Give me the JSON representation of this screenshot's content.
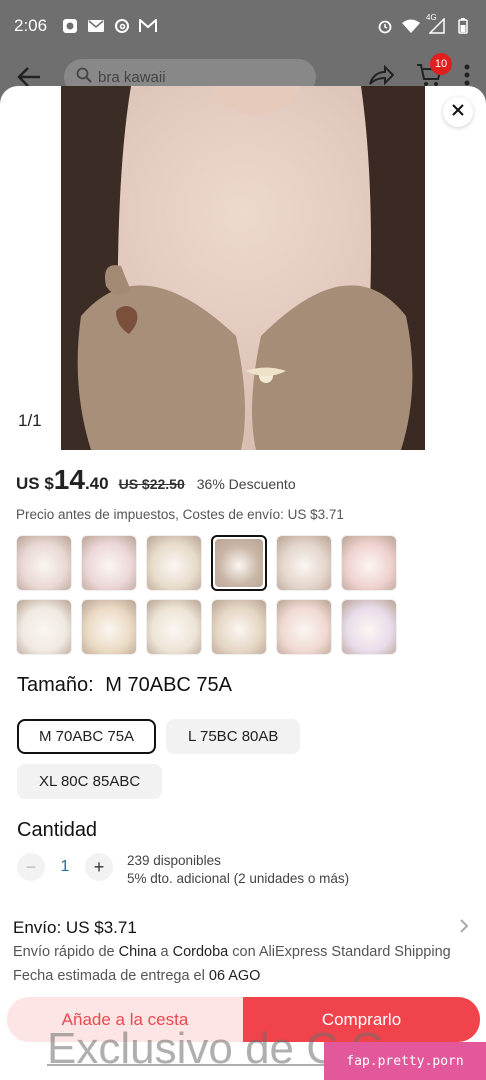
{
  "status_bar": {
    "time": "2:06",
    "network_label": "4G"
  },
  "app_bar": {
    "search_placeholder": "bra kawaii",
    "cart_badge": "10"
  },
  "sheet": {
    "image_counter": "1/1",
    "price": {
      "currency": "US $",
      "integer": "14",
      "decimal": ".40",
      "original": "US $22.50",
      "discount": "36% Descuento"
    },
    "tax_note": "Precio antes de impuestos, Costes de envío: US $3.71",
    "thumbnails": [
      {
        "name": "thumb-1",
        "color": "#e9d8d4",
        "selected": false
      },
      {
        "name": "thumb-2",
        "color": "#ecd7d8",
        "selected": false
      },
      {
        "name": "thumb-3",
        "color": "#e7dccb",
        "selected": false
      },
      {
        "name": "thumb-4",
        "color": "#c9b6a6",
        "selected": true
      },
      {
        "name": "thumb-5",
        "color": "#e3d5cb",
        "selected": false
      },
      {
        "name": "thumb-6",
        "color": "#efd2cf",
        "selected": false
      },
      {
        "name": "thumb-7",
        "color": "#efe9e1",
        "selected": false
      },
      {
        "name": "thumb-8",
        "color": "#eadac3",
        "selected": false
      },
      {
        "name": "thumb-9",
        "color": "#ece4d6",
        "selected": false
      },
      {
        "name": "thumb-10",
        "color": "#e5d6c4",
        "selected": false
      },
      {
        "name": "thumb-11",
        "color": "#f0d9d2",
        "selected": false
      },
      {
        "name": "thumb-12",
        "color": "#e8dcea",
        "selected": false
      }
    ],
    "size_label": "Tamaño:",
    "size_selected": "M 70ABC 75A",
    "sizes": [
      {
        "label": "M 70ABC 75A",
        "selected": true
      },
      {
        "label": "L 75BC 80AB",
        "selected": false
      },
      {
        "label": "XL 80C 85ABC",
        "selected": false
      }
    ],
    "quantity_title": "Cantidad",
    "quantity": {
      "minus": "−",
      "value": "1",
      "plus": "+",
      "available": "239 disponibles",
      "extra_discount": "5% dto. adicional (2 unidades o más)"
    },
    "shipping": {
      "title": "Envío: US $3.71",
      "line1_prefix": "Envío rápido de ",
      "from": "China",
      "line1_mid": " a ",
      "to": "Cordoba",
      "line1_mid2": " con ",
      "carrier": "AliExpress Standard Shipping",
      "line2_prefix": "Fecha estimada de entrega el ",
      "date": "06 AGO"
    },
    "buttons": {
      "add_to_cart": "Añade a la cesta",
      "buy": "Comprarlo"
    }
  },
  "overlay": {
    "watermark": "Exclusivo de C  G",
    "source_tag": "fap.pretty.porn"
  },
  "colors": {
    "accent": "#f0434b",
    "accent_light": "#fde4e5"
  }
}
